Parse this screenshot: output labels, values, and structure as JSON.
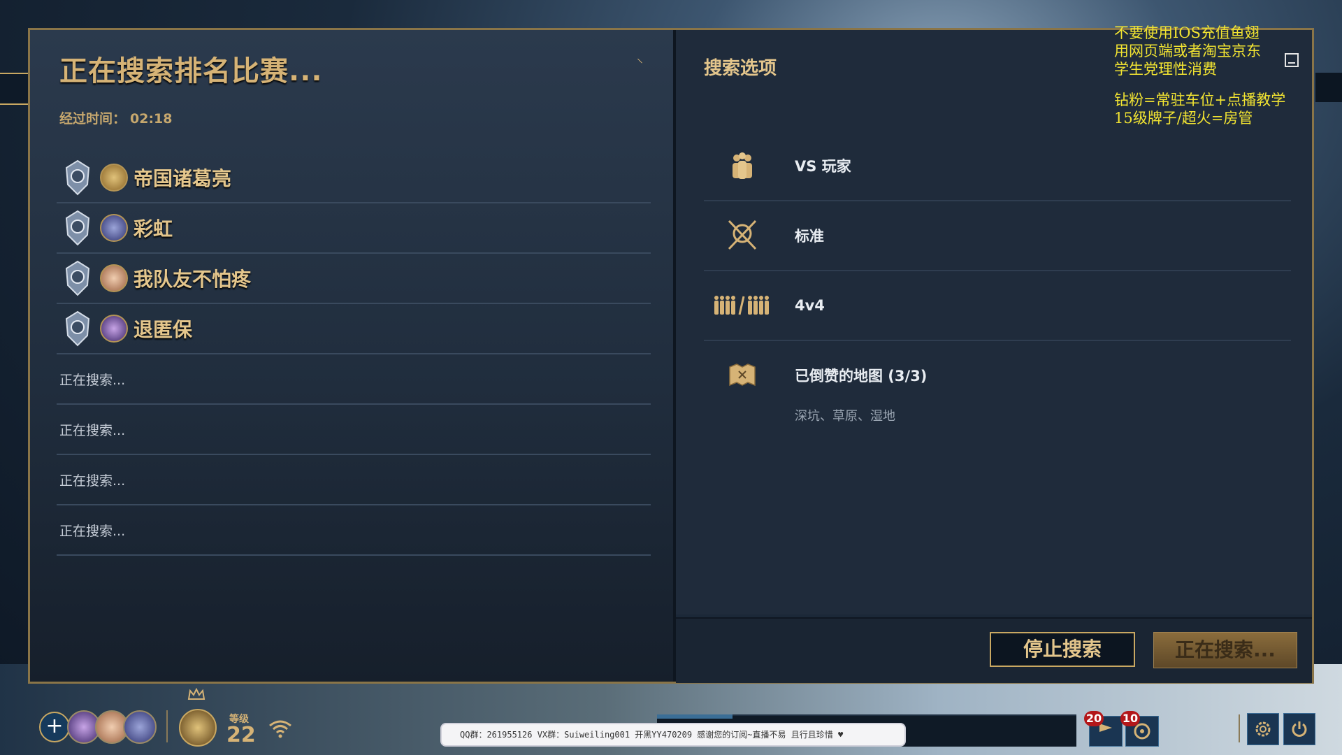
{
  "search": {
    "title": "正在搜索排名比赛...",
    "elapsed_label": "经过时间：",
    "elapsed_value": "02:18"
  },
  "players": [
    {
      "name": "帝国诸葛亮",
      "avatar_color": "#b38a3c"
    },
    {
      "name": "彩虹",
      "avatar_color": "#5a5aa8"
    },
    {
      "name": "我队友不怕疼",
      "avatar_color": "#c89a6a"
    },
    {
      "name": "退匿保",
      "avatar_color": "#6a4a9a"
    }
  ],
  "searching_slots": [
    "正在搜索...",
    "正在搜索...",
    "正在搜索...",
    "正在搜索..."
  ],
  "options": {
    "title": "搜索选项",
    "mode": "VS 玩家",
    "type": "标准",
    "team_size": "4v4",
    "maps_label": "已倒赞的地图 (3/3)",
    "maps_list": "深坑、草原、湿地"
  },
  "buttons": {
    "stop": "停止搜索",
    "searching": "正在搜索..."
  },
  "overlay": {
    "line1": "不要使用IOS充值鱼翅",
    "line2": "用网页端或者淘宝京东",
    "line3": "学生党理性消费",
    "line4": "钻粉=常驻车位+点播教学",
    "line5": "15级牌子/超火=房管"
  },
  "bottom_bar": {
    "level_label": "等级",
    "level_value": "22",
    "stream_banner": "QQ群：261955126 VX群：Suiweiling001 开黑YY470209 感谢您的订阅~直播不易 且行且珍惜 ♥",
    "notif_count_1": "20",
    "notif_count_2": "10"
  },
  "colors": {
    "gold": "#d6b376",
    "frame": "#8a7548",
    "overlay_yellow": "#f2e432"
  },
  "icons": [
    "people-icon",
    "crossed-swords-icon",
    "team-vs-icon",
    "map-icon",
    "plus-icon",
    "crown-icon",
    "wifi-icon",
    "settings-icon",
    "power-icon",
    "minimize-icon"
  ]
}
